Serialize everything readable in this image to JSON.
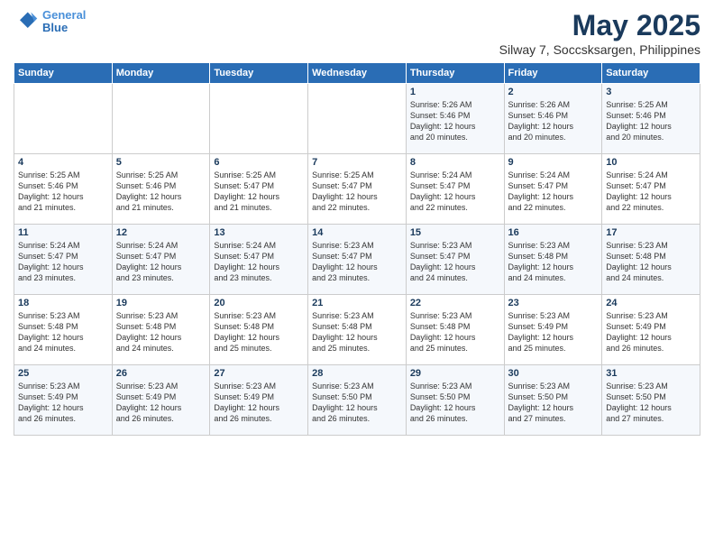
{
  "header": {
    "logo_line1": "General",
    "logo_line2": "Blue",
    "title": "May 2025",
    "subtitle": "Silway 7, Soccsksargen, Philippines"
  },
  "weekdays": [
    "Sunday",
    "Monday",
    "Tuesday",
    "Wednesday",
    "Thursday",
    "Friday",
    "Saturday"
  ],
  "weeks": [
    [
      {
        "day": "",
        "info": ""
      },
      {
        "day": "",
        "info": ""
      },
      {
        "day": "",
        "info": ""
      },
      {
        "day": "",
        "info": ""
      },
      {
        "day": "1",
        "info": "Sunrise: 5:26 AM\nSunset: 5:46 PM\nDaylight: 12 hours\nand 20 minutes."
      },
      {
        "day": "2",
        "info": "Sunrise: 5:26 AM\nSunset: 5:46 PM\nDaylight: 12 hours\nand 20 minutes."
      },
      {
        "day": "3",
        "info": "Sunrise: 5:25 AM\nSunset: 5:46 PM\nDaylight: 12 hours\nand 20 minutes."
      }
    ],
    [
      {
        "day": "4",
        "info": "Sunrise: 5:25 AM\nSunset: 5:46 PM\nDaylight: 12 hours\nand 21 minutes."
      },
      {
        "day": "5",
        "info": "Sunrise: 5:25 AM\nSunset: 5:46 PM\nDaylight: 12 hours\nand 21 minutes."
      },
      {
        "day": "6",
        "info": "Sunrise: 5:25 AM\nSunset: 5:47 PM\nDaylight: 12 hours\nand 21 minutes."
      },
      {
        "day": "7",
        "info": "Sunrise: 5:25 AM\nSunset: 5:47 PM\nDaylight: 12 hours\nand 22 minutes."
      },
      {
        "day": "8",
        "info": "Sunrise: 5:24 AM\nSunset: 5:47 PM\nDaylight: 12 hours\nand 22 minutes."
      },
      {
        "day": "9",
        "info": "Sunrise: 5:24 AM\nSunset: 5:47 PM\nDaylight: 12 hours\nand 22 minutes."
      },
      {
        "day": "10",
        "info": "Sunrise: 5:24 AM\nSunset: 5:47 PM\nDaylight: 12 hours\nand 22 minutes."
      }
    ],
    [
      {
        "day": "11",
        "info": "Sunrise: 5:24 AM\nSunset: 5:47 PM\nDaylight: 12 hours\nand 23 minutes."
      },
      {
        "day": "12",
        "info": "Sunrise: 5:24 AM\nSunset: 5:47 PM\nDaylight: 12 hours\nand 23 minutes."
      },
      {
        "day": "13",
        "info": "Sunrise: 5:24 AM\nSunset: 5:47 PM\nDaylight: 12 hours\nand 23 minutes."
      },
      {
        "day": "14",
        "info": "Sunrise: 5:23 AM\nSunset: 5:47 PM\nDaylight: 12 hours\nand 23 minutes."
      },
      {
        "day": "15",
        "info": "Sunrise: 5:23 AM\nSunset: 5:47 PM\nDaylight: 12 hours\nand 24 minutes."
      },
      {
        "day": "16",
        "info": "Sunrise: 5:23 AM\nSunset: 5:48 PM\nDaylight: 12 hours\nand 24 minutes."
      },
      {
        "day": "17",
        "info": "Sunrise: 5:23 AM\nSunset: 5:48 PM\nDaylight: 12 hours\nand 24 minutes."
      }
    ],
    [
      {
        "day": "18",
        "info": "Sunrise: 5:23 AM\nSunset: 5:48 PM\nDaylight: 12 hours\nand 24 minutes."
      },
      {
        "day": "19",
        "info": "Sunrise: 5:23 AM\nSunset: 5:48 PM\nDaylight: 12 hours\nand 24 minutes."
      },
      {
        "day": "20",
        "info": "Sunrise: 5:23 AM\nSunset: 5:48 PM\nDaylight: 12 hours\nand 25 minutes."
      },
      {
        "day": "21",
        "info": "Sunrise: 5:23 AM\nSunset: 5:48 PM\nDaylight: 12 hours\nand 25 minutes."
      },
      {
        "day": "22",
        "info": "Sunrise: 5:23 AM\nSunset: 5:48 PM\nDaylight: 12 hours\nand 25 minutes."
      },
      {
        "day": "23",
        "info": "Sunrise: 5:23 AM\nSunset: 5:49 PM\nDaylight: 12 hours\nand 25 minutes."
      },
      {
        "day": "24",
        "info": "Sunrise: 5:23 AM\nSunset: 5:49 PM\nDaylight: 12 hours\nand 26 minutes."
      }
    ],
    [
      {
        "day": "25",
        "info": "Sunrise: 5:23 AM\nSunset: 5:49 PM\nDaylight: 12 hours\nand 26 minutes."
      },
      {
        "day": "26",
        "info": "Sunrise: 5:23 AM\nSunset: 5:49 PM\nDaylight: 12 hours\nand 26 minutes."
      },
      {
        "day": "27",
        "info": "Sunrise: 5:23 AM\nSunset: 5:49 PM\nDaylight: 12 hours\nand 26 minutes."
      },
      {
        "day": "28",
        "info": "Sunrise: 5:23 AM\nSunset: 5:50 PM\nDaylight: 12 hours\nand 26 minutes."
      },
      {
        "day": "29",
        "info": "Sunrise: 5:23 AM\nSunset: 5:50 PM\nDaylight: 12 hours\nand 26 minutes."
      },
      {
        "day": "30",
        "info": "Sunrise: 5:23 AM\nSunset: 5:50 PM\nDaylight: 12 hours\nand 27 minutes."
      },
      {
        "day": "31",
        "info": "Sunrise: 5:23 AM\nSunset: 5:50 PM\nDaylight: 12 hours\nand 27 minutes."
      }
    ]
  ]
}
